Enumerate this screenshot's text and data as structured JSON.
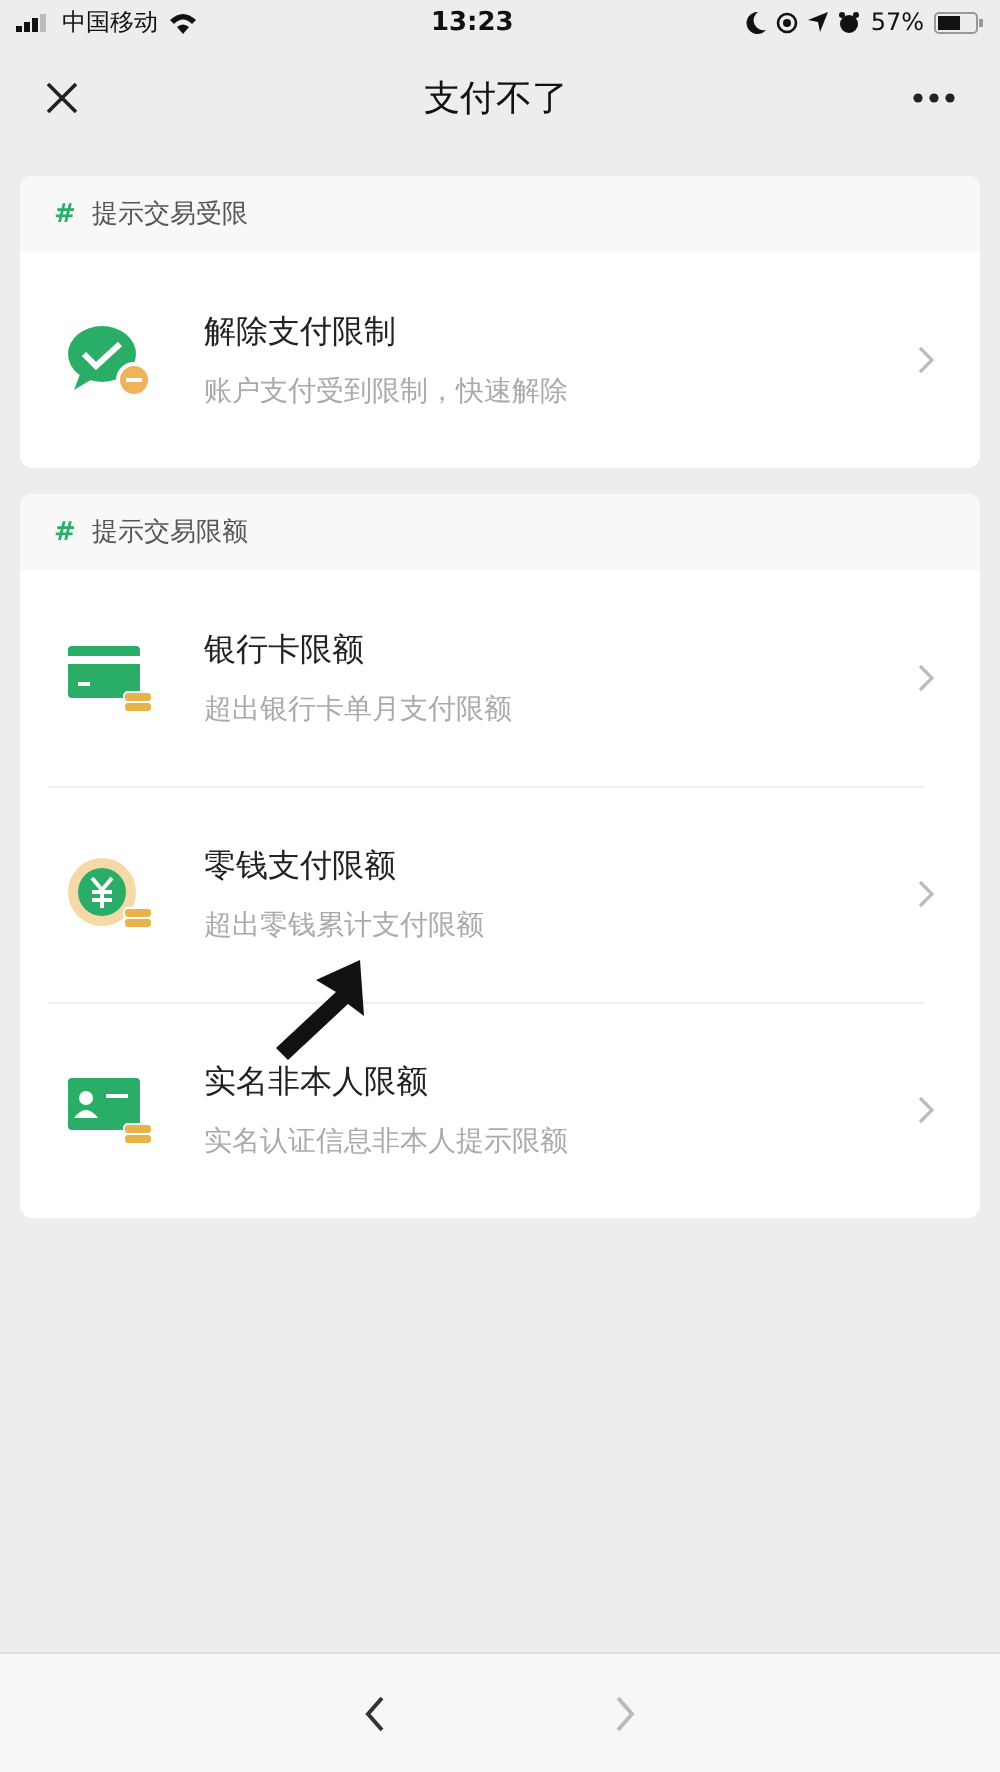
{
  "status_bar": {
    "carrier": "中国移动",
    "time": "13:23",
    "battery": "57%"
  },
  "nav": {
    "title": "支付不了"
  },
  "sections": [
    {
      "mark": "#",
      "header": "提示交易受限",
      "items": [
        {
          "kind": "chat",
          "title": "解除支付限制",
          "subtitle": "账户支付受到限制，快速解除"
        }
      ]
    },
    {
      "mark": "#",
      "header": "提示交易限额",
      "items": [
        {
          "kind": "card",
          "title": "银行卡限额",
          "subtitle": "超出银行卡单月支付限额"
        },
        {
          "kind": "coin",
          "title": "零钱支付限额",
          "subtitle": "超出零钱累计支付限额"
        },
        {
          "kind": "id",
          "title": "实名非本人限额",
          "subtitle": "实名认证信息非本人提示限额"
        }
      ]
    }
  ],
  "toolbar": {
    "buttons": [
      {
        "kind": "back",
        "disabled": false
      },
      {
        "kind": "forward",
        "disabled": true
      }
    ]
  }
}
